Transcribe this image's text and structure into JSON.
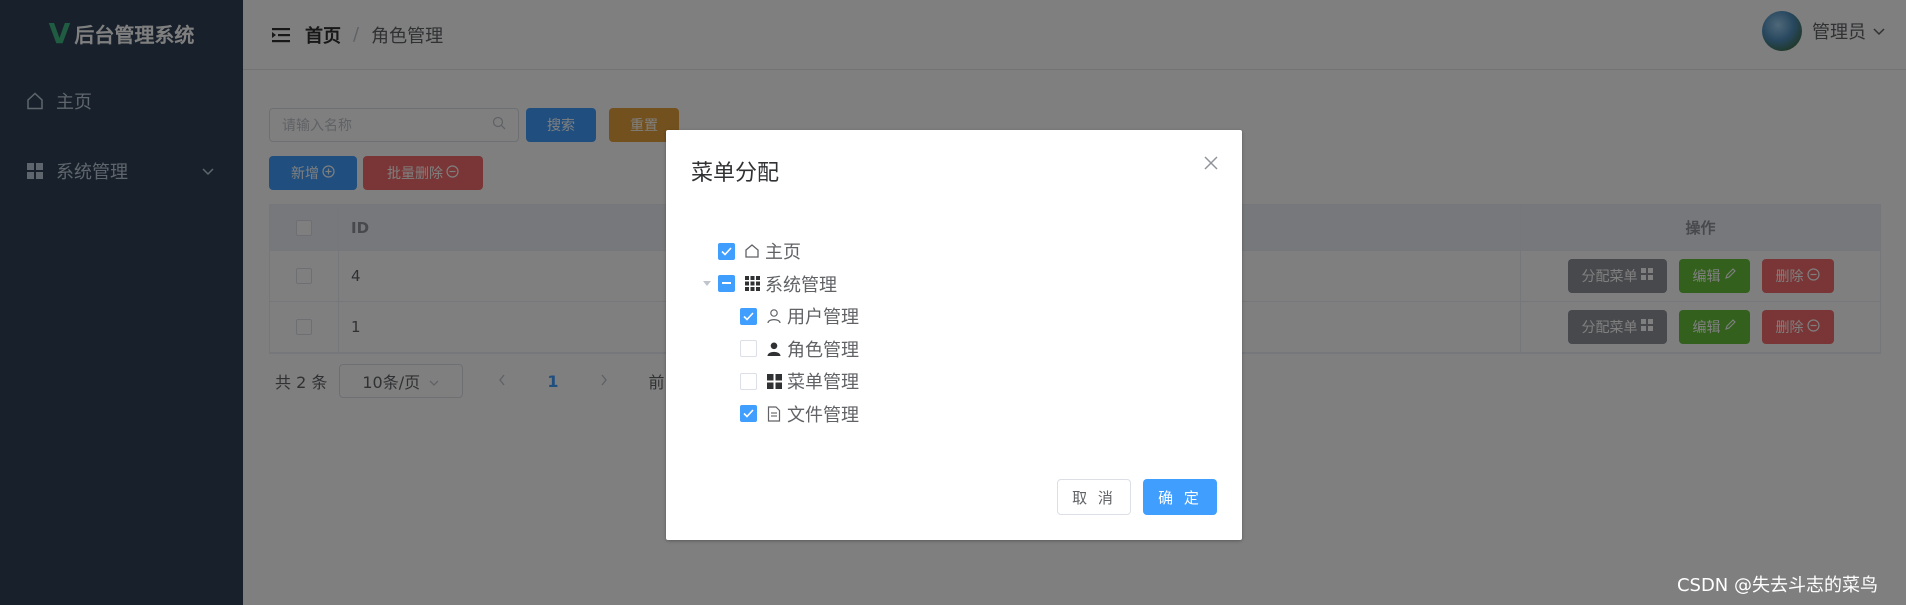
{
  "sidebar": {
    "logo_mark": "V",
    "title": "后台管理系统",
    "items": [
      {
        "label": "主页"
      },
      {
        "label": "系统管理"
      }
    ]
  },
  "header": {
    "breadcrumb_home": "首页",
    "breadcrumb_sep": "/",
    "breadcrumb_current": "角色管理",
    "user_name": "管理员"
  },
  "toolbar": {
    "search_placeholder": "请输入名称",
    "search_label": "搜索",
    "reset_label": "重置",
    "add_label": "新增",
    "batch_delete_label": "批量删除"
  },
  "table": {
    "headers": {
      "id": "ID",
      "actions": "操作"
    },
    "rows": [
      {
        "id": "4"
      },
      {
        "id": "1"
      }
    ],
    "row_actions": {
      "assign": "分配菜单",
      "edit": "编辑",
      "delete": "删除"
    }
  },
  "pager": {
    "total": "共 2 条",
    "page_size": "10条/页",
    "current_page": "1",
    "jump_prefix": "前"
  },
  "dialog": {
    "title": "菜单分配",
    "tree": [
      {
        "label": "主页",
        "icon": "house-icon",
        "state": "checked"
      },
      {
        "label": "系统管理",
        "icon": "grid-icon",
        "state": "indeterminate",
        "expanded": true,
        "children": [
          {
            "label": "用户管理",
            "icon": "user-outline-icon",
            "state": "checked"
          },
          {
            "label": "角色管理",
            "icon": "user-solid-icon",
            "state": "unchecked"
          },
          {
            "label": "菜单管理",
            "icon": "menu-grid-icon",
            "state": "unchecked"
          },
          {
            "label": "文件管理",
            "icon": "document-icon",
            "state": "checked"
          }
        ]
      }
    ],
    "cancel_label": "取 消",
    "confirm_label": "确 定"
  },
  "watermark": "CSDN @失去斗志的菜鸟",
  "colors": {
    "sidebar_bg": "#304156",
    "primary": "#409eff",
    "warning": "#e6a23c",
    "danger": "#f56c6c",
    "success": "#67c23a",
    "info": "#909399"
  }
}
